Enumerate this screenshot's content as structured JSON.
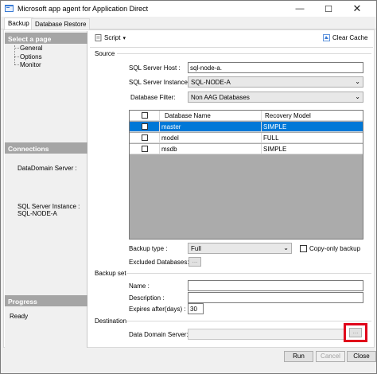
{
  "window": {
    "title": "Microsoft app agent for Application Direct",
    "minimize_glyph": "—",
    "maximize_glyph": "☐",
    "close_glyph": "✕"
  },
  "tabs": [
    {
      "label": "Backup",
      "active": true
    },
    {
      "label": "Database Restore",
      "active": false
    }
  ],
  "left_panel": {
    "select_page_header": "Select a page",
    "pages": [
      "General",
      "Options",
      "Monitor"
    ],
    "connections_header": "Connections",
    "datadomain_label": "DataDomain Server :",
    "sql_instance_label": "SQL Server Instance :",
    "sql_instance_value": "SQL-NODE-A",
    "progress_header": "Progress",
    "progress_status": "Ready"
  },
  "toolbar": {
    "script_label": "Script",
    "script_icon": "script-icon",
    "clear_cache_label": "Clear Cache",
    "clear_cache_icon": "clear-cache-icon"
  },
  "source": {
    "section_label": "Source",
    "host_label": "SQL Server Host :",
    "host_value": "sql-node-a.",
    "instance_label": "SQL Server Instance :",
    "instance_value": "SQL-NODE-A",
    "filter_label": "Database Filter:",
    "filter_value": "Non AAG Databases"
  },
  "database_grid": {
    "columns": [
      "Database Name",
      "Recovery Model"
    ],
    "rows": [
      {
        "name": "master",
        "recovery": "SIMPLE",
        "selected": true
      },
      {
        "name": "model",
        "recovery": "FULL",
        "selected": false
      },
      {
        "name": "msdb",
        "recovery": "SIMPLE",
        "selected": false
      }
    ]
  },
  "backup_options": {
    "backup_type_label": "Backup type :",
    "backup_type_value": "Full",
    "copy_only_label": "Copy-only backup",
    "excluded_label": "Excluded Databases:",
    "browse_label": "..."
  },
  "backup_set": {
    "section_label": "Backup set",
    "name_label": "Name :",
    "name_value": "",
    "description_label": "Description :",
    "description_value": "",
    "expires_label": "Expires after(days) :",
    "expires_value": "30"
  },
  "destination": {
    "section_label": "Destination",
    "server_label": "Data Domain Server:",
    "server_value": "",
    "browse_label": "..."
  },
  "buttons": {
    "run": "Run",
    "cancel": "Cancel",
    "close": "Close"
  },
  "colors": {
    "selection": "#0078d7",
    "highlight": "#e0001a",
    "panel_header": "#a5a5a5"
  }
}
